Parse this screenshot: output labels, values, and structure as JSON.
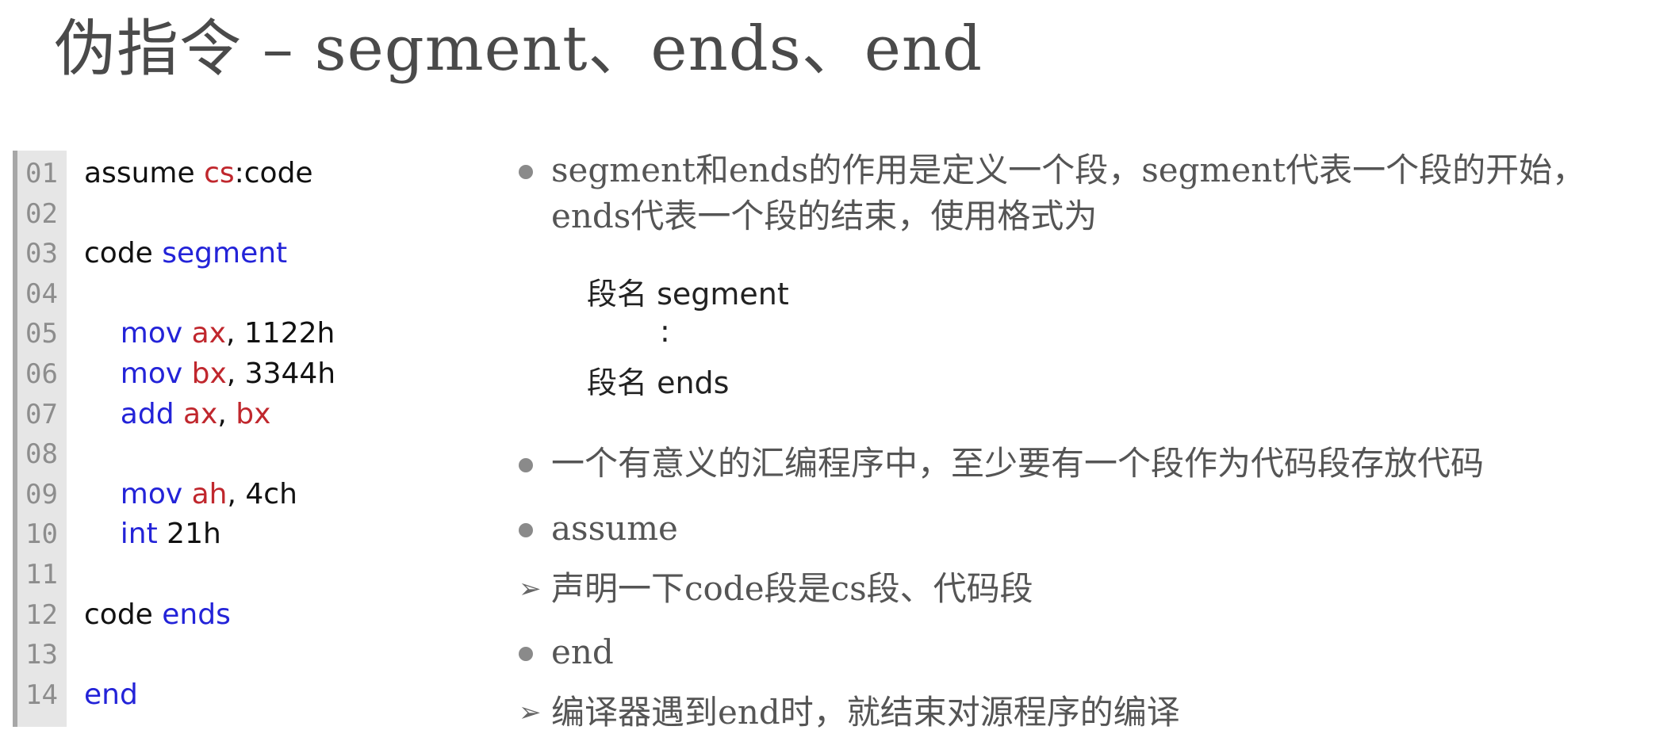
{
  "title": "伪指令  –  segment、ends、end",
  "code": {
    "lines": [
      {
        "no": "01",
        "tokens": [
          [
            "plain",
            "assume "
          ],
          [
            "reg",
            "cs"
          ],
          [
            "plain",
            ":code"
          ]
        ]
      },
      {
        "no": "02",
        "tokens": []
      },
      {
        "no": "03",
        "tokens": [
          [
            "plain",
            "code "
          ],
          [
            "kw",
            "segment"
          ]
        ]
      },
      {
        "no": "04",
        "tokens": []
      },
      {
        "no": "05",
        "tokens": [
          [
            "plain",
            "    "
          ],
          [
            "kw",
            "mov "
          ],
          [
            "reg",
            "ax"
          ],
          [
            "plain",
            ", "
          ],
          [
            "num",
            "1122h"
          ]
        ]
      },
      {
        "no": "06",
        "tokens": [
          [
            "plain",
            "    "
          ],
          [
            "kw",
            "mov "
          ],
          [
            "reg",
            "bx"
          ],
          [
            "plain",
            ", "
          ],
          [
            "num",
            "3344h"
          ]
        ]
      },
      {
        "no": "07",
        "tokens": [
          [
            "plain",
            "    "
          ],
          [
            "kw",
            "add "
          ],
          [
            "reg",
            "ax"
          ],
          [
            "plain",
            ", "
          ],
          [
            "reg",
            "bx"
          ]
        ]
      },
      {
        "no": "08",
        "tokens": []
      },
      {
        "no": "09",
        "tokens": [
          [
            "plain",
            "    "
          ],
          [
            "kw",
            "mov "
          ],
          [
            "reg",
            "ah"
          ],
          [
            "plain",
            ", "
          ],
          [
            "num",
            "4ch"
          ]
        ]
      },
      {
        "no": "10",
        "tokens": [
          [
            "plain",
            "    "
          ],
          [
            "kw",
            "int "
          ],
          [
            "num",
            "21h"
          ]
        ]
      },
      {
        "no": "11",
        "tokens": []
      },
      {
        "no": "12",
        "tokens": [
          [
            "plain",
            "code "
          ],
          [
            "kw",
            "ends"
          ]
        ]
      },
      {
        "no": "13",
        "tokens": []
      },
      {
        "no": "14",
        "tokens": [
          [
            "kw",
            "end"
          ]
        ]
      }
    ]
  },
  "bullets": {
    "b1_line1": "segment和ends的作用是定义一个段，segment代表一个段的开始，",
    "b1_line2": "ends代表一个段的结束，使用格式为",
    "b2": "一个有意义的汇编程序中，至少要有一个段作为代码段存放代码",
    "b3": "assume",
    "b3_sub": "声明一下code段是cs段、代码段",
    "b4": "end",
    "b4_sub": "编译器遇到end时，就结束对源程序的编译"
  },
  "format": {
    "line1": "段名 segment",
    "line2": ":",
    "line3": "段名 ends"
  },
  "colors": {
    "keyword": "#2323d8",
    "register": "#c0272d",
    "text": "#555555"
  }
}
